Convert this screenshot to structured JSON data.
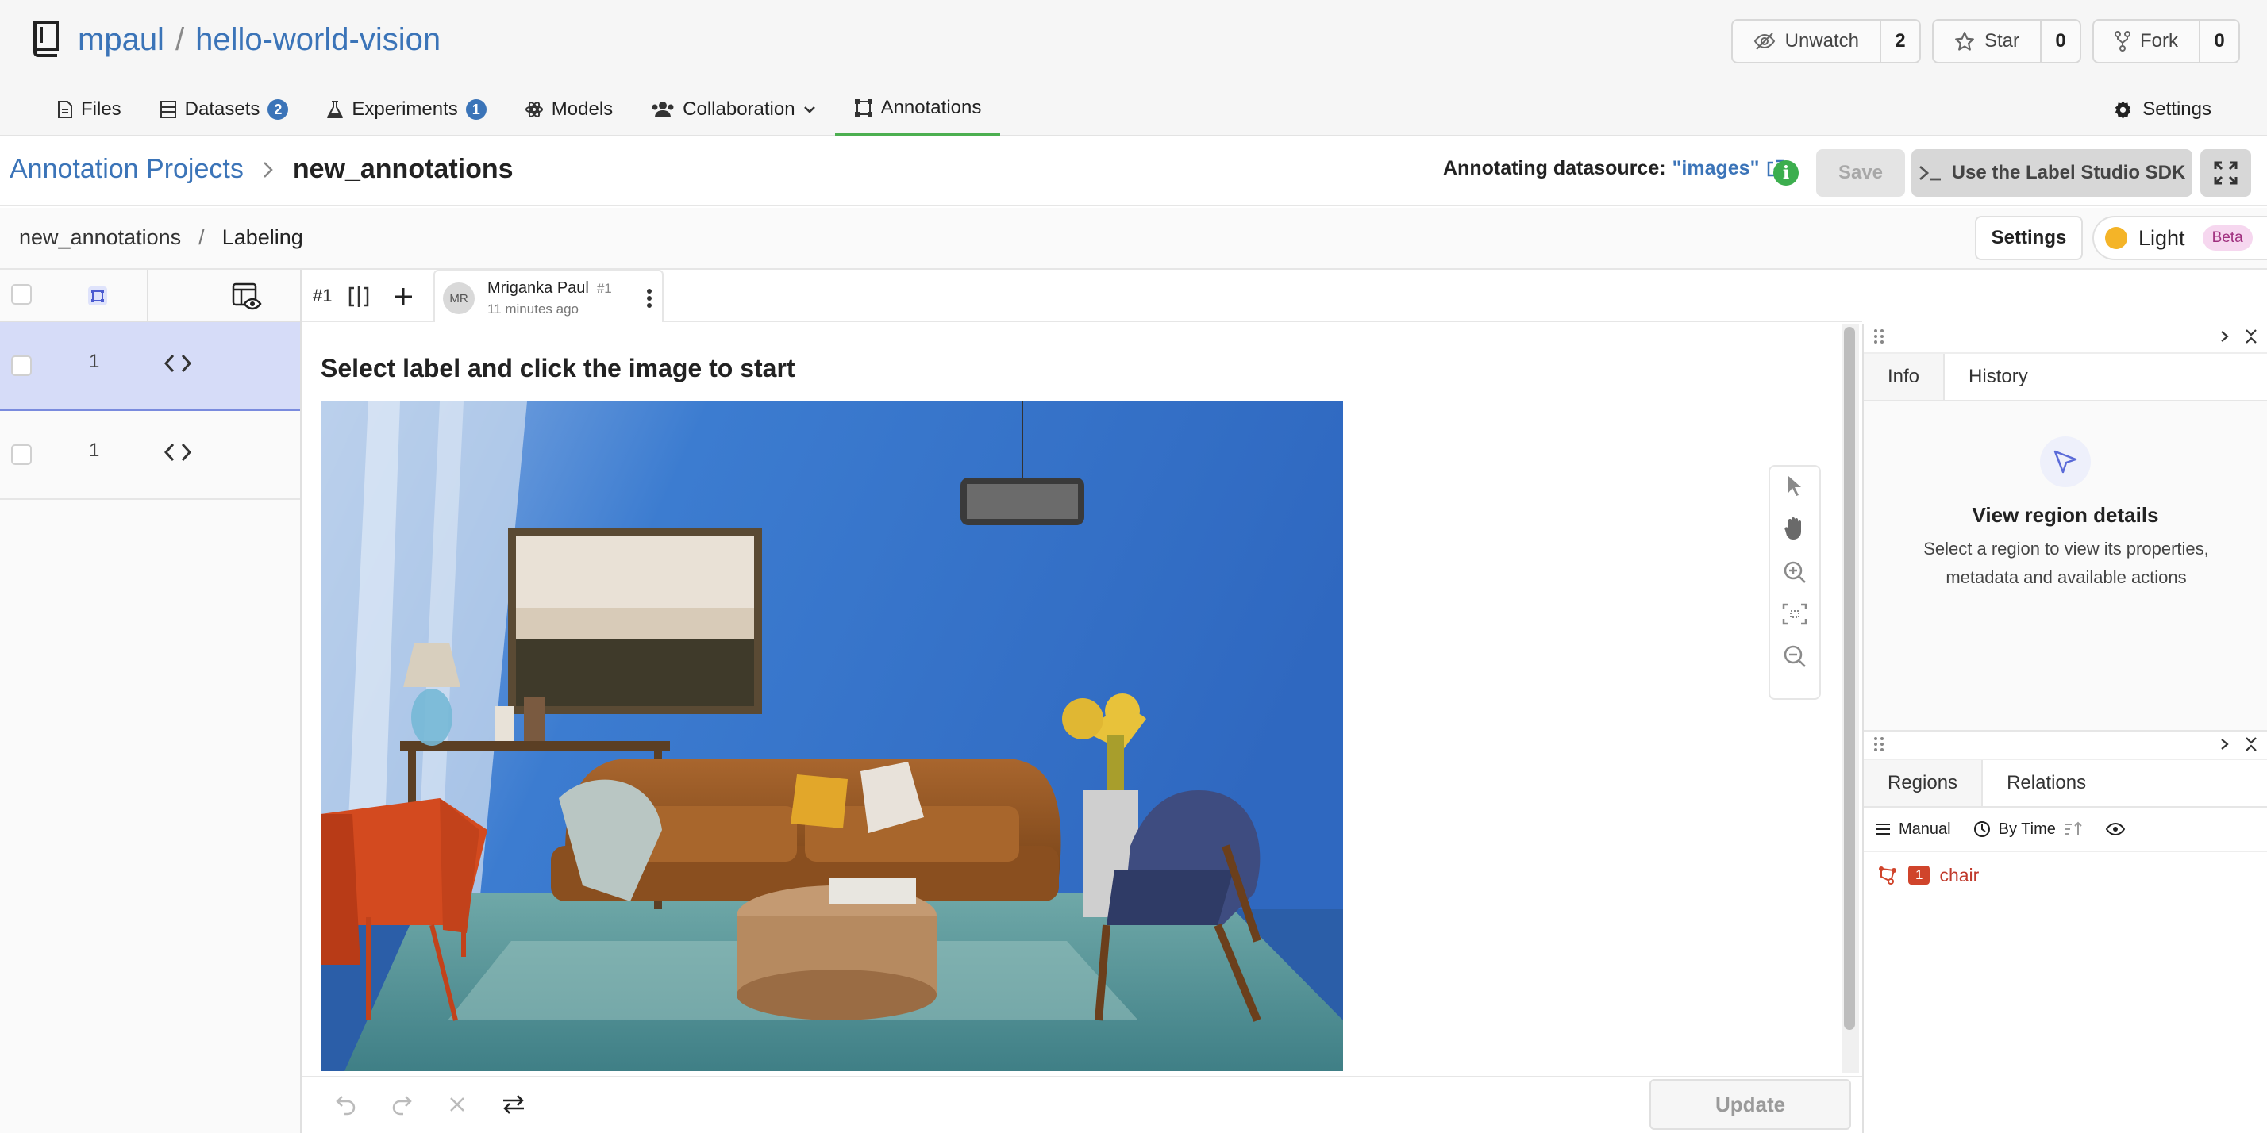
{
  "repo": {
    "owner": "mpaul",
    "separator": "/",
    "name": "hello-world-vision"
  },
  "header_buttons": [
    {
      "label": "Unwatch",
      "count": "2",
      "icon": "eye-slash-icon"
    },
    {
      "label": "Star",
      "count": "0",
      "icon": "star-icon"
    },
    {
      "label": "Fork",
      "count": "0",
      "icon": "fork-icon"
    }
  ],
  "nav_tabs": [
    {
      "label": "Files",
      "icon": "file-icon",
      "badge": ""
    },
    {
      "label": "Datasets",
      "icon": "database-icon",
      "badge": "2"
    },
    {
      "label": "Experiments",
      "icon": "flask-icon",
      "badge": "1"
    },
    {
      "label": "Models",
      "icon": "model-icon",
      "badge": ""
    },
    {
      "label": "Collaboration",
      "icon": "users-icon",
      "badge": ""
    },
    {
      "label": "Annotations",
      "icon": "bounding-box-icon",
      "badge": "",
      "active": true
    }
  ],
  "settings_tab": "Settings",
  "breadcrumb": {
    "root": "Annotation Projects",
    "current": "new_annotations"
  },
  "datasource": {
    "label": "Annotating datasource:",
    "value": "\"images\""
  },
  "actions": {
    "save": "Save",
    "sdk": "Use the Label Studio SDK",
    "info": "i"
  },
  "ls_breadcrumb": {
    "project": "new_annotations",
    "separator": "/",
    "page": "Labeling"
  },
  "ls_settings": "Settings",
  "theme": {
    "label": "Light",
    "badge": "Beta"
  },
  "tasks": [
    {
      "count": "1",
      "selected": true
    },
    {
      "count": "1",
      "selected": false
    }
  ],
  "annotation_tab": {
    "id": "#1",
    "initials": "MR",
    "author": "Mriganka Paul",
    "num": "#1",
    "time": "11 minutes ago"
  },
  "instruction": "Select label and click the image to start",
  "footer": {
    "update": "Update"
  },
  "right_panel": {
    "tabs1": [
      "Info",
      "History"
    ],
    "empty_title": "View region details",
    "empty_desc": "Select a region to view its properties, metadata and available actions",
    "tabs2": [
      "Regions",
      "Relations"
    ],
    "sort": {
      "manual": "Manual",
      "by_time": "By Time"
    },
    "regions": [
      {
        "index": "1",
        "label": "chair"
      }
    ]
  },
  "colors": {
    "link": "#3b74b8",
    "active_tab": "#4caf50",
    "selected_row": "#d6dcf8",
    "region_label": "#d0442b"
  }
}
